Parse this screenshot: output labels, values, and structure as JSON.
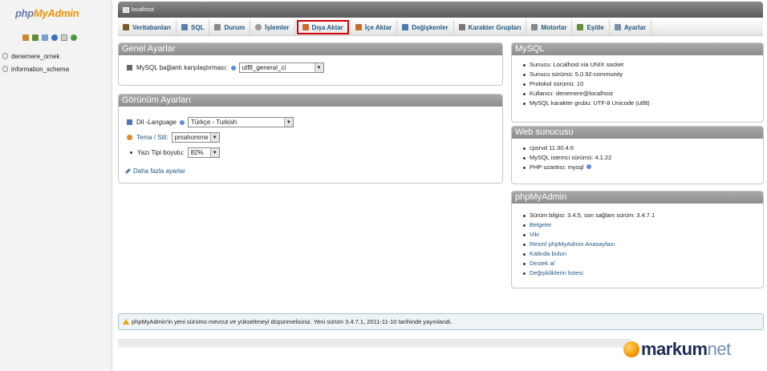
{
  "logo": {
    "php": "php",
    "my": "My",
    "admin": "Admin"
  },
  "nav_icons": [
    "home-icon",
    "query-icon",
    "sql-icon",
    "help-icon",
    "docs-icon",
    "reload-icon"
  ],
  "databases": [
    "denemere_ornek",
    "information_schema"
  ],
  "server": {
    "name": "localhost"
  },
  "tabs": [
    {
      "label": "Veritabanları",
      "icon": "databases-icon",
      "color": "#7a5a2a"
    },
    {
      "label": "SQL",
      "icon": "sql-icon",
      "color": "#5a7fb3"
    },
    {
      "label": "Durum",
      "icon": "status-icon",
      "color": "#8a8a8a"
    },
    {
      "label": "İşlemler",
      "icon": "processes-icon",
      "color": "#9a9a9a"
    },
    {
      "label": "Dışa Aktar",
      "icon": "export-icon",
      "color": "#c96b2b"
    },
    {
      "label": "İçe Aktar",
      "icon": "import-icon",
      "color": "#c96b2b"
    },
    {
      "label": "Değişkenler",
      "icon": "variables-icon",
      "color": "#4a79b5"
    },
    {
      "label": "Karakter Grupları",
      "icon": "charset-icon",
      "color": "#777777"
    },
    {
      "label": "Motorlar",
      "icon": "engines-icon",
      "color": "#888888"
    },
    {
      "label": "Eşitle",
      "icon": "sync-icon",
      "color": "#5f8d3b"
    },
    {
      "label": "Ayarlar",
      "icon": "settings-icon",
      "color": "#7a8fa8"
    }
  ],
  "active_tab": "Dışa Aktar",
  "general": {
    "title": "Genel Ayarlar",
    "collation_label": "MySQL bağlantı karşılaştırması:",
    "collation_value": "utf8_general_ci"
  },
  "appearance": {
    "title": "Görünüm Ayarları",
    "language_label": "Dil - ",
    "language_label_italic": "Language",
    "language_value": "Türkçe - Turkish",
    "theme_label": "Tema / Stil:",
    "theme_value": "pmahomme",
    "font_label": "Yazı Tipi boyutu:",
    "font_value": "82%",
    "more_link": "Daha fazla ayarlar"
  },
  "mysql": {
    "title": "MySQL",
    "items": [
      "Sunucu: Localhost via UNIX socket",
      "Sunucu sürümü: 5.0.92-community",
      "Protokol sürümü: 10",
      "Kullanıcı: denemere@localhost",
      "MySQL karakter grubu: UTF-8 Unicode (utf8)"
    ]
  },
  "web": {
    "title": "Web sunucusu",
    "items": [
      "cpsrvd 11.30.4.6",
      "MySQL istemci sürümü: 4.1.22",
      "PHP uzantısı: mysql"
    ]
  },
  "pma": {
    "title": "phpMyAdmin",
    "version": "Sürüm bilgisi: 3.4.5, son sağlam sürüm: 3.4.7.1",
    "links": [
      "Belgeler",
      "Viki",
      "Resmî phpMyAdmin Anasayfası",
      "Katkıda bulun",
      "Destek al",
      "Değişikliklerin listesi"
    ]
  },
  "notice": "phpMyAdmin'in yeni sürümü mevcut ve yükseltmeyi düşünmelisiniz. Yeni sürüm 3.4.7.1, 2011-11-10 tarihinde yayınlandı.",
  "watermark": {
    "brand": "markum",
    "suffix": "net"
  },
  "colors": {
    "link": "#235a81",
    "active_border": "#d40000",
    "panel_header": "#999999"
  }
}
